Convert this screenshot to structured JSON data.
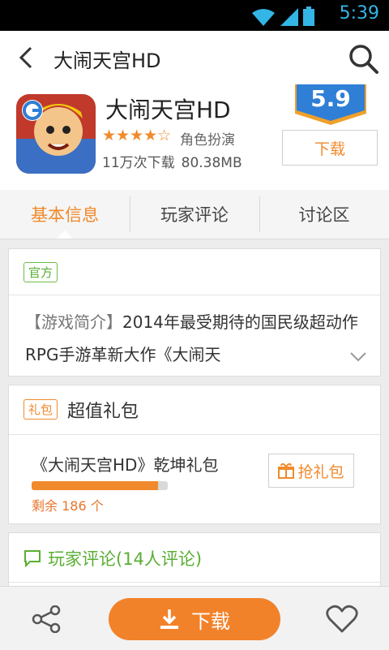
{
  "status_bar": {
    "time": "5:39"
  },
  "header": {
    "title": "大闹天宫HD",
    "back_icon": "back-arrow-icon",
    "search_icon": "search-icon"
  },
  "app": {
    "name": "大闹天宫HD",
    "rating_stars": "★★★★☆",
    "rating_value": 4,
    "rating_max": 5,
    "category": "角色扮演",
    "downloads": "11万次下载",
    "size": "80.38MB",
    "score": "5.9",
    "download_label": "下载"
  },
  "tabs": [
    {
      "label": "基本信息",
      "active": true
    },
    {
      "label": "玩家评论",
      "active": false
    },
    {
      "label": "讨论区",
      "active": false
    }
  ],
  "intro": {
    "badge": "官方",
    "label": "【游戏简介】",
    "text": "2014年最受期待的国民级超动作RPG手游革新大作《大闹天"
  },
  "gifts": {
    "badge": "礼包",
    "title": "超值礼包",
    "item_name": "《大闹天宫HD》乾坤礼包",
    "progress": 0.93,
    "remaining": "剩余 186 个",
    "button": "抢礼包"
  },
  "reviews": {
    "title": "玩家评论(14人评论)"
  },
  "bottom_bar": {
    "download_label": "下载"
  },
  "colors": {
    "accent": "#f08a2c",
    "green": "#5aae33",
    "badge_blue": "#2f7fd6"
  }
}
